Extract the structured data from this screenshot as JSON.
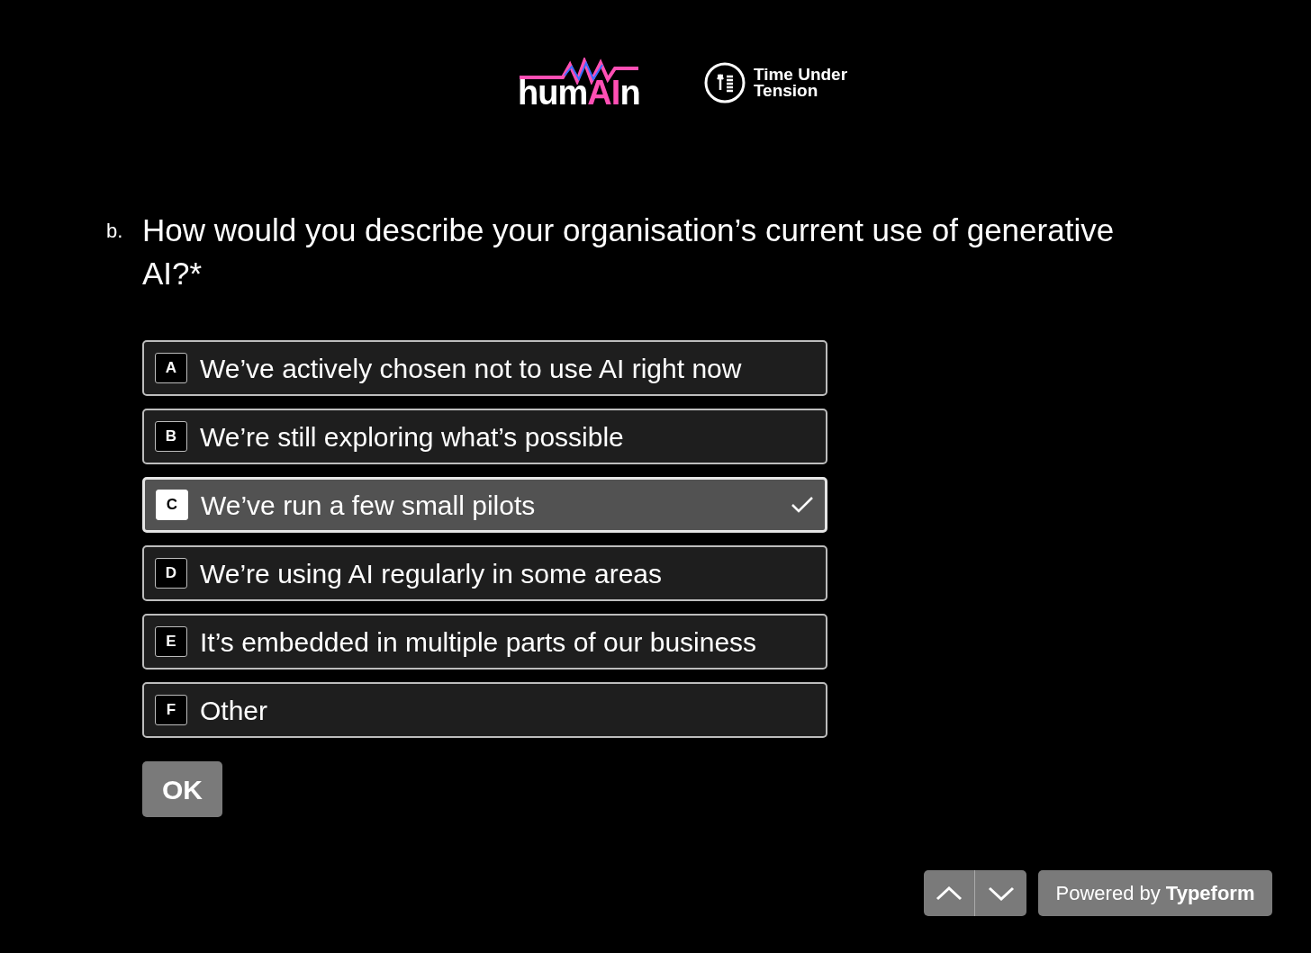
{
  "logos": [
    {
      "kind": "humain",
      "parts": [
        "hum",
        "AI",
        "n"
      ]
    },
    {
      "kind": "tut",
      "lines": [
        "Time Under",
        "Tension"
      ]
    }
  ],
  "question": {
    "number": "b.",
    "text": "How would you describe your organisation’s current use of generative AI?*"
  },
  "options": [
    {
      "key": "A",
      "label": "We’ve actively chosen not to use AI right now",
      "selected": false
    },
    {
      "key": "B",
      "label": "We’re still exploring what’s possible",
      "selected": false
    },
    {
      "key": "C",
      "label": "We’ve run a few small pilots",
      "selected": true
    },
    {
      "key": "D",
      "label": "We’re using AI regularly in some areas",
      "selected": false
    },
    {
      "key": "E",
      "label": "It’s embedded in multiple parts of our business",
      "selected": false
    },
    {
      "key": "F",
      "label": "Other",
      "selected": false
    }
  ],
  "ok_button": "OK",
  "powered_by": "Powered by **Typeform**"
}
